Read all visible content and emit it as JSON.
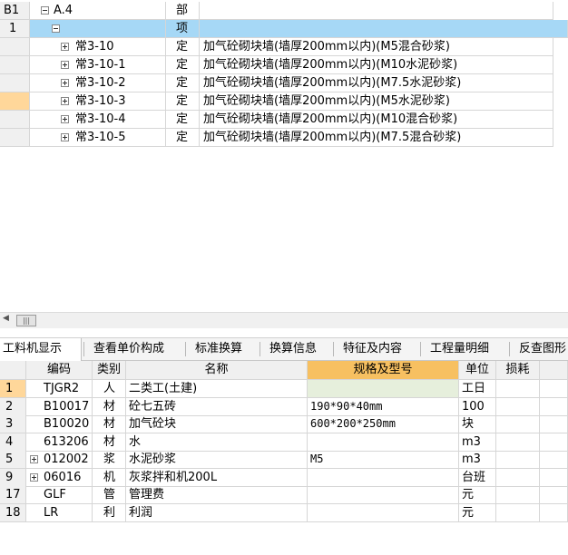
{
  "top": {
    "header_row": {
      "id": "B1",
      "code": "A.4",
      "kind": "部",
      "name": ""
    },
    "row1": {
      "num": "1",
      "kind": "项",
      "name": ""
    },
    "items": [
      {
        "code": "常3-10",
        "kind": "定",
        "name": "加气砼砌块墙(墙厚200mm以内)(M5混合砂浆)"
      },
      {
        "code": "常3-10-1",
        "kind": "定",
        "name": "加气砼砌块墙(墙厚200mm以内)(M10水泥砂浆)"
      },
      {
        "code": "常3-10-2",
        "kind": "定",
        "name": "加气砼砌块墙(墙厚200mm以内)(M7.5水泥砂浆)"
      },
      {
        "code": "常3-10-3",
        "kind": "定",
        "name": "加气砼砌块墙(墙厚200mm以内)(M5水泥砂浆)"
      },
      {
        "code": "常3-10-4",
        "kind": "定",
        "name": "加气砼砌块墙(墙厚200mm以内)(M10混合砂浆)"
      },
      {
        "code": "常3-10-5",
        "kind": "定",
        "name": "加气砼砌块墙(墙厚200mm以内)(M7.5混合砂浆)"
      }
    ]
  },
  "scrollbar": {
    "thumb_glyph": "|||",
    "left_arrow": "◀"
  },
  "tabs": [
    "工料机显示",
    "查看单价构成",
    "标准换算",
    "换算信息",
    "特征及内容",
    "工程量明细",
    "反查图形"
  ],
  "bottom": {
    "headers": {
      "code": "编码",
      "cat": "类别",
      "name": "名称",
      "spec": "规格及型号",
      "unit": "单位",
      "loss": "损耗"
    },
    "rows": [
      {
        "num": "1",
        "code": "TJGR2",
        "cat": "人",
        "name": "二类工(土建)",
        "spec": "",
        "unit": "工日",
        "expand": false
      },
      {
        "num": "2",
        "code": "B10017",
        "cat": "材",
        "name": "砼七五砖",
        "spec": "190*90*40mm",
        "unit": "100",
        "expand": false
      },
      {
        "num": "3",
        "code": "B10020",
        "cat": "材",
        "name": "加气砼块",
        "spec": "600*200*250mm",
        "unit": "块",
        "expand": false
      },
      {
        "num": "4",
        "code": "613206",
        "cat": "材",
        "name": "水",
        "spec": "",
        "unit": "m3",
        "expand": false
      },
      {
        "num": "5",
        "code": "012002",
        "cat": "浆",
        "name": "水泥砂浆",
        "spec": "M5",
        "unit": "m3",
        "expand": true
      },
      {
        "num": "9",
        "code": "06016",
        "cat": "机",
        "name": "灰浆拌和机200L",
        "spec": "",
        "unit": "台班",
        "expand": true
      },
      {
        "num": "17",
        "code": "GLF",
        "cat": "管",
        "name": "管理费",
        "spec": "",
        "unit": "元",
        "expand": false
      },
      {
        "num": "18",
        "code": "LR",
        "cat": "利",
        "name": "利润",
        "spec": "",
        "unit": "元",
        "expand": false
      }
    ]
  },
  "colors": {
    "selected_row": "#a6d8f6",
    "highlight_rowhdr": "#ffd79a",
    "spec_header": "#f7c061",
    "spec_cell_edit": "#e6efdc"
  }
}
